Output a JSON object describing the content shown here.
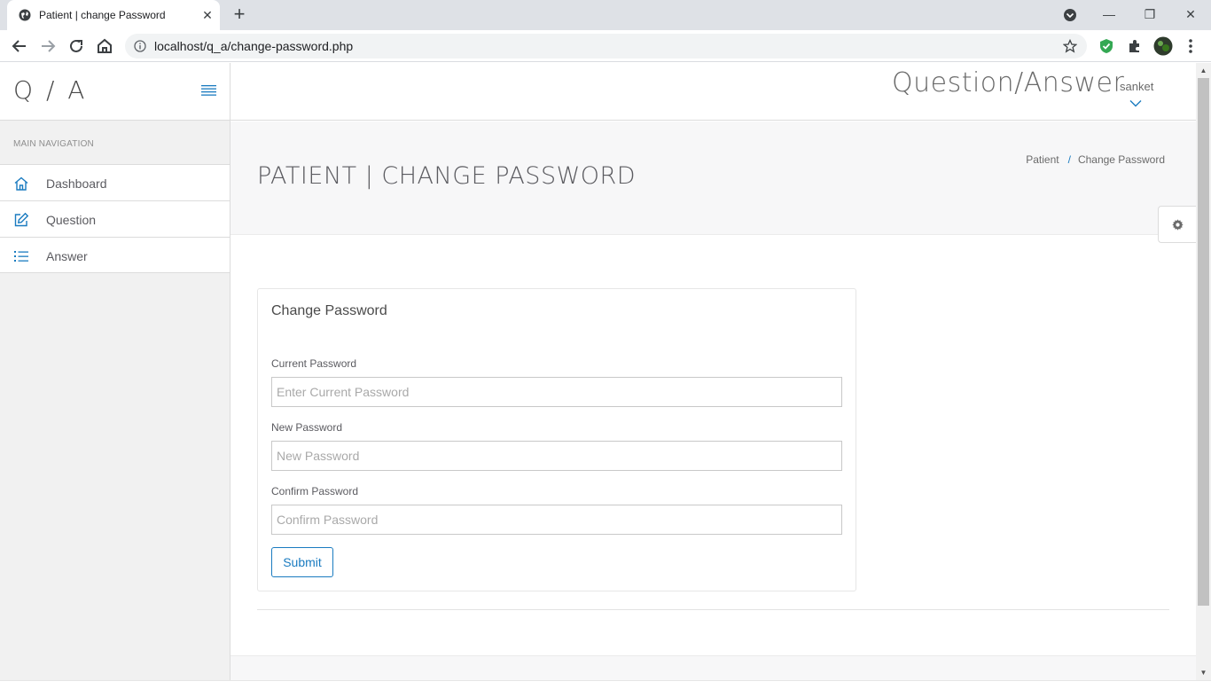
{
  "browser": {
    "tab_title": "Patient | change Password",
    "url": "localhost/q_a/change-password.php"
  },
  "sidebar": {
    "brand": "Q / A",
    "nav_heading": "MAIN NAVIGATION",
    "items": [
      {
        "label": "Dashboard",
        "icon": "home-icon"
      },
      {
        "label": "Question",
        "icon": "edit-icon"
      },
      {
        "label": "Answer",
        "icon": "list-icon"
      }
    ]
  },
  "header": {
    "app_title": "Question/Answer",
    "user_name": "sanket"
  },
  "page": {
    "title": "PATIENT | CHANGE PASSWORD",
    "breadcrumb": [
      "Patient",
      "Change Password"
    ]
  },
  "form": {
    "panel_title": "Change Password",
    "fields": [
      {
        "label": "Current Password",
        "placeholder": "Enter Current Password",
        "value": ""
      },
      {
        "label": "New Password",
        "placeholder": "New Password",
        "value": ""
      },
      {
        "label": "Confirm Password",
        "placeholder": "Confirm Password",
        "value": ""
      }
    ],
    "submit_label": "Submit"
  },
  "colors": {
    "accent": "#1a7bc0",
    "sidebar_bg": "#f1f1f1",
    "page_head_bg": "#f7f7f8"
  }
}
